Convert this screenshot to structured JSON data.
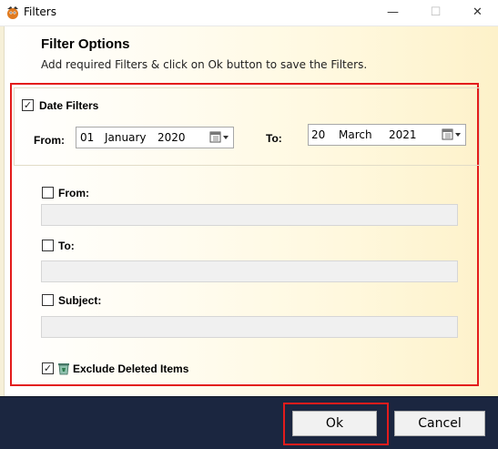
{
  "window": {
    "title": "Filters",
    "min_glyph": "—",
    "max_glyph": "☐",
    "close_glyph": "✕"
  },
  "header": {
    "title": "Filter Options",
    "subtitle": "Add required Filters & click on Ok button to save the Filters."
  },
  "date_filters": {
    "label": "Date Filters",
    "checked": true,
    "check_glyph": "✓",
    "from_label": "From:",
    "to_label": "To:",
    "from_date": {
      "day": "01",
      "month": "January",
      "year": "2020"
    },
    "to_date": {
      "day": "20",
      "month": "March",
      "year": "2021"
    }
  },
  "fields": {
    "from": {
      "label": "From:",
      "checked": false,
      "value": ""
    },
    "to": {
      "label": "To:",
      "checked": false,
      "value": ""
    },
    "subject": {
      "label": "Subject:",
      "checked": false,
      "value": ""
    }
  },
  "exclude_deleted": {
    "label": "Exclude Deleted Items",
    "checked": true,
    "check_glyph": "✓",
    "icon": "recycle-bin-icon"
  },
  "buttons": {
    "ok": "Ok",
    "cancel": "Cancel"
  },
  "colors": {
    "highlight": "#e31c1c",
    "footer": "#1b2640"
  }
}
